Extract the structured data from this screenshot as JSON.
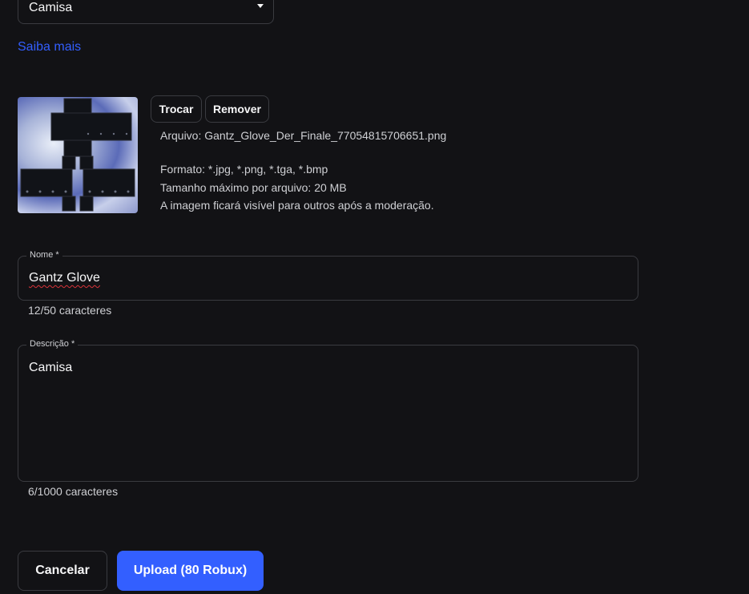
{
  "category_select": {
    "value": "Camisa"
  },
  "learn_more": "Saiba mais",
  "image_actions": {
    "replace": "Trocar",
    "remove": "Remover"
  },
  "file_info": {
    "file": "Arquivo: Gantz_Glove_Der_Finale_77054815706651.png",
    "format": "Formato: *.jpg, *.png, *.tga, *.bmp",
    "max_size": "Tamanho máximo por arquivo: 20 MB",
    "moderation": "A imagem ficará visível para outros após a moderação."
  },
  "name_field": {
    "label": "Nome *",
    "value": "Gantz Glove",
    "counter": "12/50 caracteres"
  },
  "description_field": {
    "label": "Descrição *",
    "value": "Camisa",
    "counter": "6/1000 caracteres"
  },
  "actions": {
    "cancel": "Cancelar",
    "upload": "Upload (80 Robux)"
  },
  "colors": {
    "background": "#121215",
    "accent": "#335fff",
    "border": "#3a3b40",
    "text": "#f7f7f8",
    "muted": "#cfd0d4",
    "spellcheck": "#d9343a"
  },
  "icons": {
    "select_caret": "caret-down-icon"
  }
}
